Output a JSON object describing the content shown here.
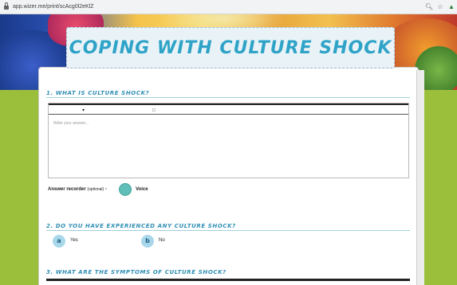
{
  "browser": {
    "url": "app.wizer.me/print/scAcg0l2eKlZ",
    "icons": [
      "lock-icon",
      "zoom-icon",
      "star-icon",
      "profile-icon"
    ]
  },
  "header": {
    "title": "COPING WITH CULTURE SHOCK"
  },
  "questions": [
    {
      "number": "1.",
      "title": "1. WHAT IS CULTURE SHOCK?",
      "answer_placeholder": "Write your answer...",
      "recorder_label": "Answer recorder",
      "recorder_optional": "(optional)",
      "recorder_dash": "-",
      "voice_label": "Voice"
    },
    {
      "title": "2. DO YOU HAVE EXPERIENCED ANY CULTURE SHOCK?",
      "options": [
        {
          "letter": "a",
          "label": "Yes"
        },
        {
          "letter": "b",
          "label": "No"
        }
      ]
    },
    {
      "title": "3. WHAT ARE THE SYMPTOMS OF CULTURE SHOCK?"
    }
  ],
  "colors": {
    "accent": "#2fa3c7",
    "background": "#9bbf3a",
    "voice_button": "#5fbfb8"
  }
}
